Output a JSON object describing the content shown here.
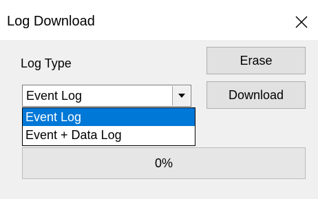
{
  "window": {
    "title": "Log Download"
  },
  "labels": {
    "log_type": "Log Type"
  },
  "buttons": {
    "erase": "Erase",
    "download": "Download"
  },
  "log_type_select": {
    "value": "Event Log",
    "options": [
      "Event Log",
      "Event + Data Log"
    ],
    "selected_index": 0,
    "expanded": true
  },
  "progress": {
    "text": "0%",
    "value": 0
  },
  "icons": {
    "close": "close-icon",
    "dropdown_arrow": "chevron-down-icon"
  },
  "colors": {
    "selection": "#0078d7",
    "client_background": "#f0f0f0"
  }
}
